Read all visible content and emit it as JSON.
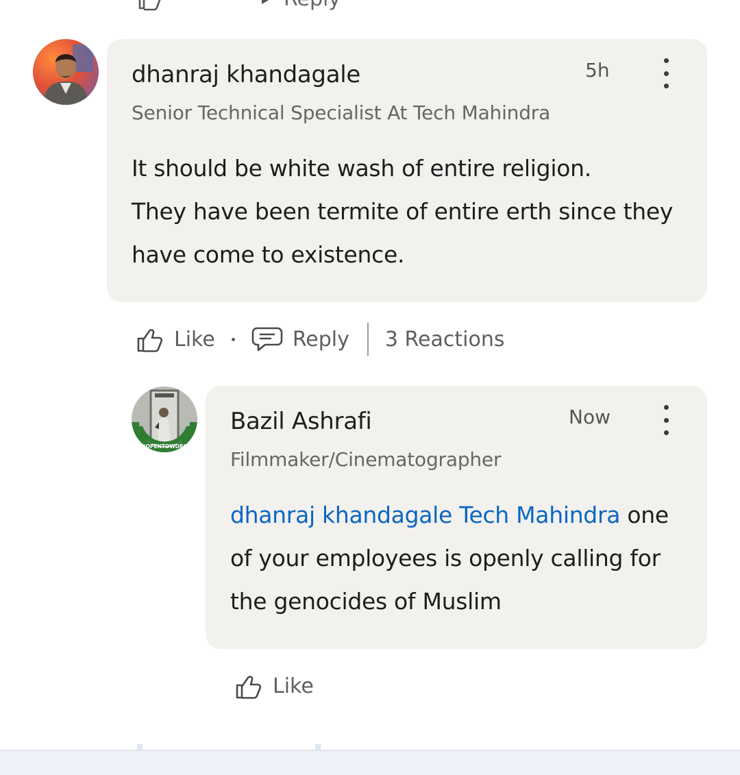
{
  "prev": {
    "like_label": "Like",
    "reply_label": "Reply"
  },
  "comments": [
    {
      "author": "dhanraj khandagale",
      "headline": "Senior Technical Specialist At Tech Mahindra",
      "time": "5h",
      "lines": [
        "It should be white wash of entire religion.",
        "They have been termite of entire erth since they",
        "have come to existence."
      ],
      "like_label": "Like",
      "reply_label": "Reply",
      "reactions": "3 Reactions"
    }
  ],
  "reply": {
    "author": "Bazil Ashrafi",
    "headline": "Filmmaker/Cinematographer",
    "time": "Now",
    "avatar_frame_text": "#OPENTOWORK",
    "mention": "dhanraj khandagale Tech Mahindra",
    "line1_rest": " one",
    "line2": "of your employees is openly calling for",
    "line3": "the genocides of Muslim",
    "like_label": "Like"
  },
  "colors": {
    "bubble": "#f2f1ee",
    "mention": "#0a66c2",
    "open_to_work": "#2f7d32"
  }
}
